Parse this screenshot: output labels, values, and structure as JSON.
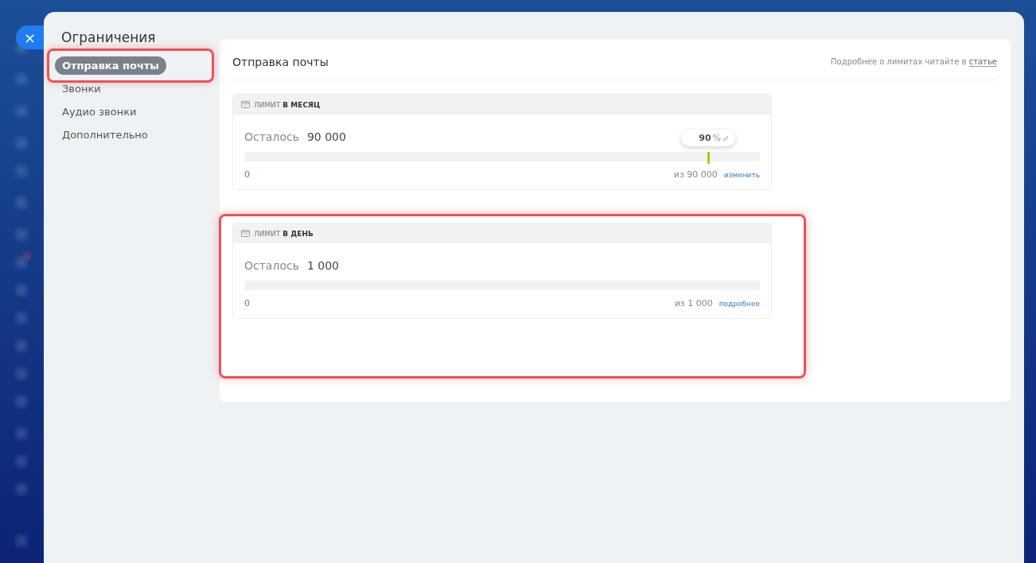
{
  "close_button": {
    "label": "×"
  },
  "sidebar": {
    "title": "Ограничения",
    "items": [
      {
        "label": "Отправка почты",
        "selected": true,
        "highlighted": true
      },
      {
        "label": "Звонки",
        "selected": false,
        "highlighted": false
      },
      {
        "label": "Аудио звонки",
        "selected": false,
        "highlighted": false
      },
      {
        "label": "Дополнительно",
        "selected": false,
        "highlighted": false
      }
    ]
  },
  "content": {
    "title": "Отправка почты",
    "hint": "Подробнее о лимитах читайте в",
    "hint_link": "статье",
    "limits": [
      {
        "header": "ЛИМИТ **В МЕСЯЦ**",
        "remaining_label": "Осталось",
        "remaining": "90 000",
        "min": "0",
        "max": "из 90 000",
        "action": "изменить",
        "highlighted": false,
        "threshold": {
          "label": "90",
          "unit": "%",
          "level": 0.9
        }
      },
      {
        "header": "ЛИМИТ **В ДЕНЬ**",
        "remaining_label": "Осталось",
        "remaining": "1 000",
        "min": "0",
        "max": "из 1 000",
        "action": "подробнее",
        "highlighted": true
      }
    ]
  }
}
